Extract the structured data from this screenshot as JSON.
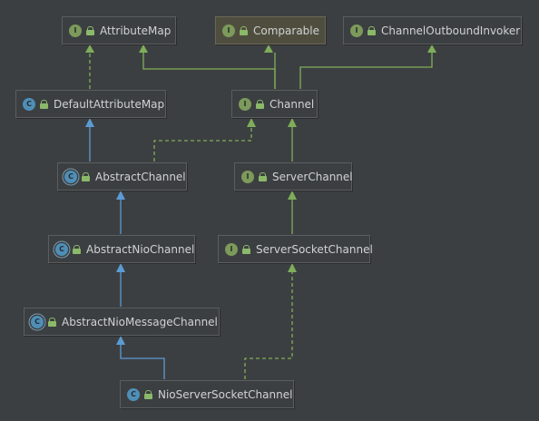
{
  "nodes": [
    {
      "id": "AttributeMap",
      "label": "AttributeMap",
      "kind": "interface",
      "badge": "I"
    },
    {
      "id": "Comparable",
      "label": "Comparable",
      "kind": "interface",
      "badge": "I",
      "highlight": true
    },
    {
      "id": "ChannelOutboundInvoker",
      "label": "ChannelOutboundInvoker",
      "kind": "interface",
      "badge": "I"
    },
    {
      "id": "DefaultAttributeMap",
      "label": "DefaultAttributeMap",
      "kind": "class",
      "badge": "C"
    },
    {
      "id": "Channel",
      "label": "Channel",
      "kind": "interface",
      "badge": "I"
    },
    {
      "id": "AbstractChannel",
      "label": "AbstractChannel",
      "kind": "abstract",
      "badge": "C"
    },
    {
      "id": "ServerChannel",
      "label": "ServerChannel",
      "kind": "interface",
      "badge": "I"
    },
    {
      "id": "AbstractNioChannel",
      "label": "AbstractNioChannel",
      "kind": "abstract",
      "badge": "C"
    },
    {
      "id": "ServerSocketChannel",
      "label": "ServerSocketChannel",
      "kind": "interface",
      "badge": "I"
    },
    {
      "id": "AbstractNioMessageChannel",
      "label": "AbstractNioMessageChannel",
      "kind": "abstract",
      "badge": "C"
    },
    {
      "id": "NioServerSocketChannel",
      "label": "NioServerSocketChannel",
      "kind": "class",
      "badge": "C"
    }
  ],
  "edges": [
    {
      "from": "DefaultAttributeMap",
      "to": "AttributeMap",
      "type": "implements"
    },
    {
      "from": "Channel",
      "to": "AttributeMap",
      "type": "extends-interface"
    },
    {
      "from": "Channel",
      "to": "Comparable",
      "type": "extends-interface"
    },
    {
      "from": "Channel",
      "to": "ChannelOutboundInvoker",
      "type": "extends-interface"
    },
    {
      "from": "AbstractChannel",
      "to": "DefaultAttributeMap",
      "type": "extends"
    },
    {
      "from": "AbstractChannel",
      "to": "Channel",
      "type": "implements"
    },
    {
      "from": "ServerChannel",
      "to": "Channel",
      "type": "extends-interface"
    },
    {
      "from": "AbstractNioChannel",
      "to": "AbstractChannel",
      "type": "extends"
    },
    {
      "from": "ServerSocketChannel",
      "to": "ServerChannel",
      "type": "extends-interface"
    },
    {
      "from": "AbstractNioMessageChannel",
      "to": "AbstractNioChannel",
      "type": "extends"
    },
    {
      "from": "NioServerSocketChannel",
      "to": "AbstractNioMessageChannel",
      "type": "extends"
    },
    {
      "from": "NioServerSocketChannel",
      "to": "ServerSocketChannel",
      "type": "implements"
    }
  ],
  "colors": {
    "background": "#3c3f41",
    "extends": "#5b9bd5",
    "interface_edge": "#7fae5a",
    "interface_badge": "#7c9a5b",
    "class_badge": "#4e8fb8",
    "text": "#d0d2d4",
    "highlight_box": "#4f4e3e"
  }
}
